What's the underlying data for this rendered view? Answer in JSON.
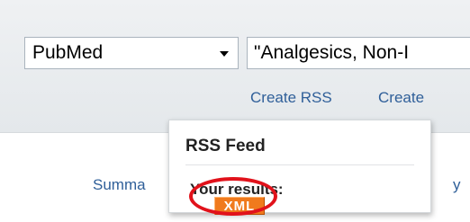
{
  "search": {
    "database": "PubMed",
    "term": "\"Analgesics, Non-I"
  },
  "links": {
    "create_rss": "Create RSS",
    "create_alert": "Create"
  },
  "view_links": {
    "summary": "Summa",
    "y": "y"
  },
  "rss_popup": {
    "title": "RSS Feed",
    "results_label": "Your results:",
    "xml_badge": "XML"
  },
  "colors": {
    "link": "#2f5f99",
    "xml_badge": "#f07a1d",
    "highlight_circle": "#e1121b"
  }
}
